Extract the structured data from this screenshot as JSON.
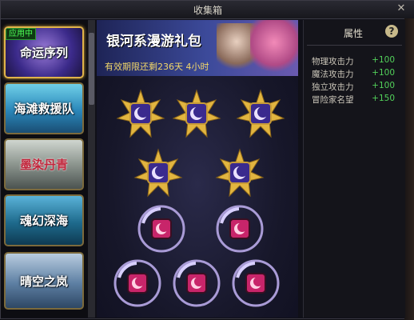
{
  "window": {
    "title": "收集箱",
    "close_glyph": "✕"
  },
  "list": {
    "active_badge": "应用中",
    "items": [
      {
        "label": "命运序列"
      },
      {
        "label": "海滩救援队"
      },
      {
        "label": "墨染丹青"
      },
      {
        "label": "魂幻深海"
      },
      {
        "label": "晴空之岚"
      }
    ]
  },
  "banner": {
    "title": "银河系漫游礼包",
    "validity_prefix": "有效期限还剩",
    "validity_days": "236天",
    "validity_hours": "4小时"
  },
  "slots": {
    "purple_icon": "moon-gear-icon",
    "pink_icon": "pink-moon-icon",
    "purple_frame_color": "#e2b540",
    "pink_frame_color": "#a99bd6"
  },
  "attributes": {
    "title": "属性",
    "help_glyph": "?",
    "stats": [
      {
        "name": "物理攻击力",
        "value": "+100"
      },
      {
        "name": "魔法攻击力",
        "value": "+100"
      },
      {
        "name": "独立攻击力",
        "value": "+100"
      },
      {
        "name": "冒险家名望",
        "value": "+150"
      }
    ]
  }
}
